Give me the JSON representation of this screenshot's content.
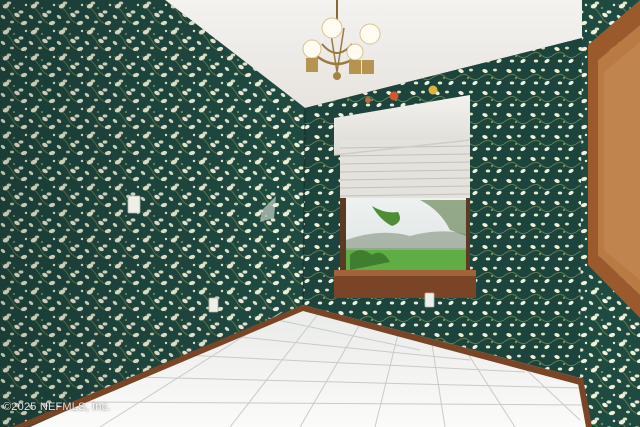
{
  "photo": {
    "watermark": "©2025 NEFMLS, Inc.",
    "room": "empty dining room",
    "features": [
      "floral-wallpaper",
      "chandelier",
      "window-with-blinds",
      "tile-floor",
      "wood-baseboard",
      "door-frame"
    ]
  },
  "colors": {
    "wallpaper": "#1f4a42",
    "ceiling": "#f1efec",
    "floor": "#f3f4f2",
    "baseboard": "#7a4526",
    "trim": "#9a5a2c",
    "blossom": "#eef0da",
    "grass": "#5fae45"
  }
}
